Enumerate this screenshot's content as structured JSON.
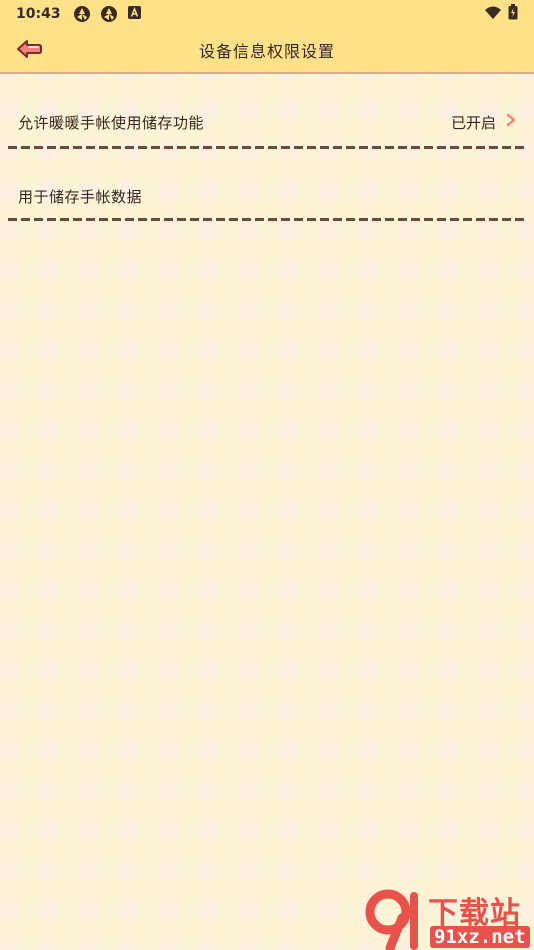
{
  "status_bar": {
    "time": "10:43",
    "icons": [
      "aperture-icon",
      "aperture-icon",
      "a-box-icon"
    ],
    "right_icons": [
      "wifi-icon",
      "battery-icon"
    ]
  },
  "header": {
    "title": "设备信息权限设置",
    "back_icon": "back-arrow-icon"
  },
  "settings": [
    {
      "label": "允许暖暖手帐使用储存功能",
      "value": "已开启",
      "chevron": "chevron-right-icon"
    },
    {
      "label": "用于储存手帐数据"
    }
  ],
  "watermark": {
    "top_text": "下载站",
    "bottom_text": "91xz.net"
  },
  "colors": {
    "header_bg": "#fde28a",
    "accent": "#f08a78",
    "text": "#3a2620",
    "watermark_red": "#e8524a"
  }
}
